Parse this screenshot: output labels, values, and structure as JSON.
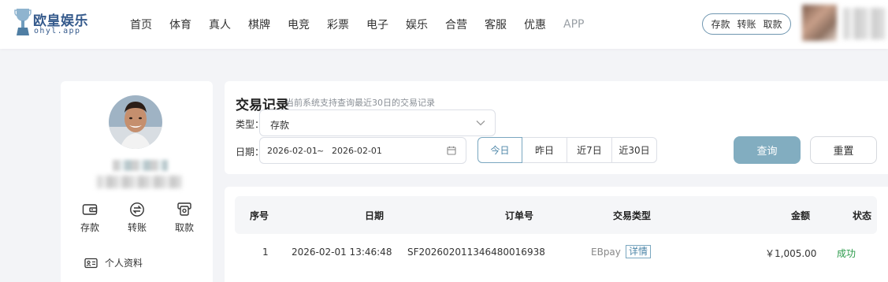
{
  "header": {
    "brand": "欧皇娱乐",
    "domain": "ohyl.app",
    "nav": [
      "首页",
      "体育",
      "真人",
      "棋牌",
      "电竞",
      "彩票",
      "电子",
      "娱乐",
      "合营",
      "客服",
      "优惠",
      "APP"
    ],
    "quick_actions": [
      "存款",
      "转账",
      "取款"
    ]
  },
  "sidebar": {
    "actions": [
      {
        "label": "存款",
        "icon": "wallet-icon"
      },
      {
        "label": "转账",
        "icon": "transfer-icon"
      },
      {
        "label": "取款",
        "icon": "withdraw-icon"
      }
    ],
    "profile_label": "个人资料",
    "profile_icon": "id-card-icon"
  },
  "filter": {
    "title": "交易记录",
    "subtitle": "当前系统支持查询最近30日的交易记录",
    "type_label": "类型：",
    "type_value": "存款",
    "date_label": "日期：",
    "date_start": "2026-02-01",
    "date_sep": "~",
    "date_end": "2026-02-01",
    "ranges": [
      "今日",
      "昨日",
      "近7日",
      "近30日"
    ],
    "active_range": "今日",
    "query_label": "查询",
    "reset_label": "重置"
  },
  "table": {
    "headers": [
      "序号",
      "日期",
      "订单号",
      "交易类型",
      "金额",
      "状态"
    ],
    "rows": [
      {
        "index": "1",
        "date": "2026-02-01 13:46:48",
        "order_no": "SF202602011346480016938",
        "type": "EBpay",
        "detail_label": "详情",
        "amount": "￥1,005.00",
        "status": "成功"
      }
    ]
  },
  "colors": {
    "accent": "#82adc0",
    "brand": "#355a8c",
    "success": "#2a9a4a",
    "background": "#f3f4f7"
  }
}
